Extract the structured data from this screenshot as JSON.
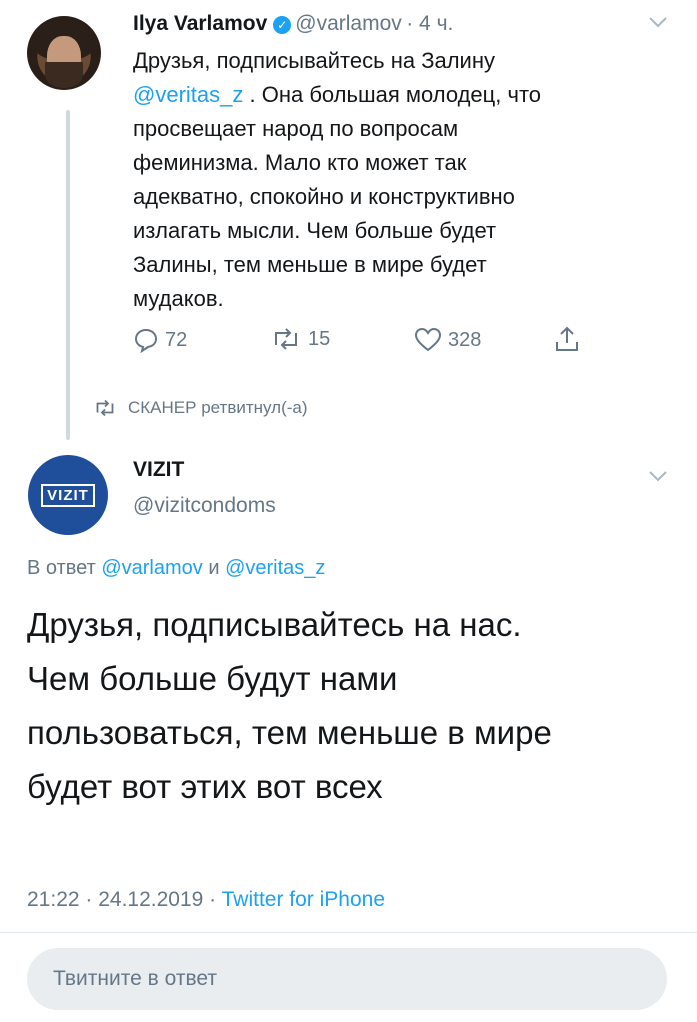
{
  "tweet1": {
    "name": "Ilya Varlamov",
    "handle": "@varlamov",
    "time": "· 4 ч.",
    "text_lines": [
      "Друзья, подписывайтесь на Залину",
      "",
      "просвещает народ по вопросам",
      "феминизма. Мало кто может так",
      "адекватно, спокойно и конструктивно",
      "излагать мысли. Чем больше будет",
      "Залины, тем меньше в мире будет",
      "мудаков."
    ],
    "line2_mention": "@veritas_z",
    "line2_rest": " . Она большая молодец, что",
    "replies": "72",
    "retweets": "15",
    "likes": "328"
  },
  "retweet_note": "СКАНЕР ретвитнул(-а)",
  "tweet2": {
    "avatar_logo": "VIZIT",
    "name": "VIZIT",
    "handle": "@vizitcondoms",
    "reply_prefix": "В ответ ",
    "reply_user1": "@varlamov",
    "reply_and": " и ",
    "reply_user2": "@veritas_z",
    "text_lines": [
      "Друзья, подписывайтесь на нас.",
      "Чем больше будут нами",
      "пользоваться, тем меньше в мире",
      "будет вот этих вот всех"
    ],
    "timestamp": "21:22 · 24.12.2019 · ",
    "source": "Twitter for iPhone"
  },
  "reply_placeholder": "Твитните в ответ",
  "colors": {
    "accent": "#1da1f2",
    "muted": "#657786",
    "vizit_blue": "#1f4f9a"
  },
  "icons": [
    "verified-icon",
    "chevron-down-icon",
    "reply-icon",
    "retweet-icon",
    "like-icon",
    "share-icon"
  ]
}
